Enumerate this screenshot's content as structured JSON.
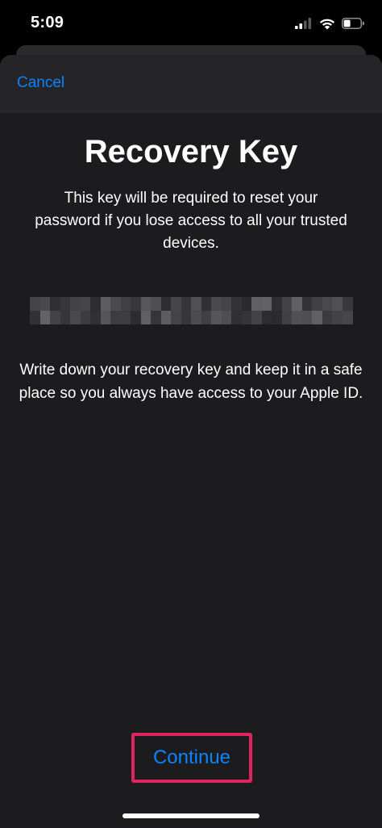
{
  "status_bar": {
    "time": "5:09",
    "icons": [
      "cellular-signal-icon",
      "wifi-icon",
      "battery-icon"
    ]
  },
  "nav": {
    "cancel_label": "Cancel"
  },
  "content": {
    "title": "Recovery Key",
    "description": "This key will be required to reset your password if you lose access to all your trusted devices.",
    "instructions": "Write down your recovery key and keep it in a safe place so you always have access to your Apple ID."
  },
  "footer": {
    "continue_label": "Continue"
  },
  "colors": {
    "accent": "#0a84ff",
    "highlight": "#e0245e",
    "background": "#1c1c1e"
  }
}
